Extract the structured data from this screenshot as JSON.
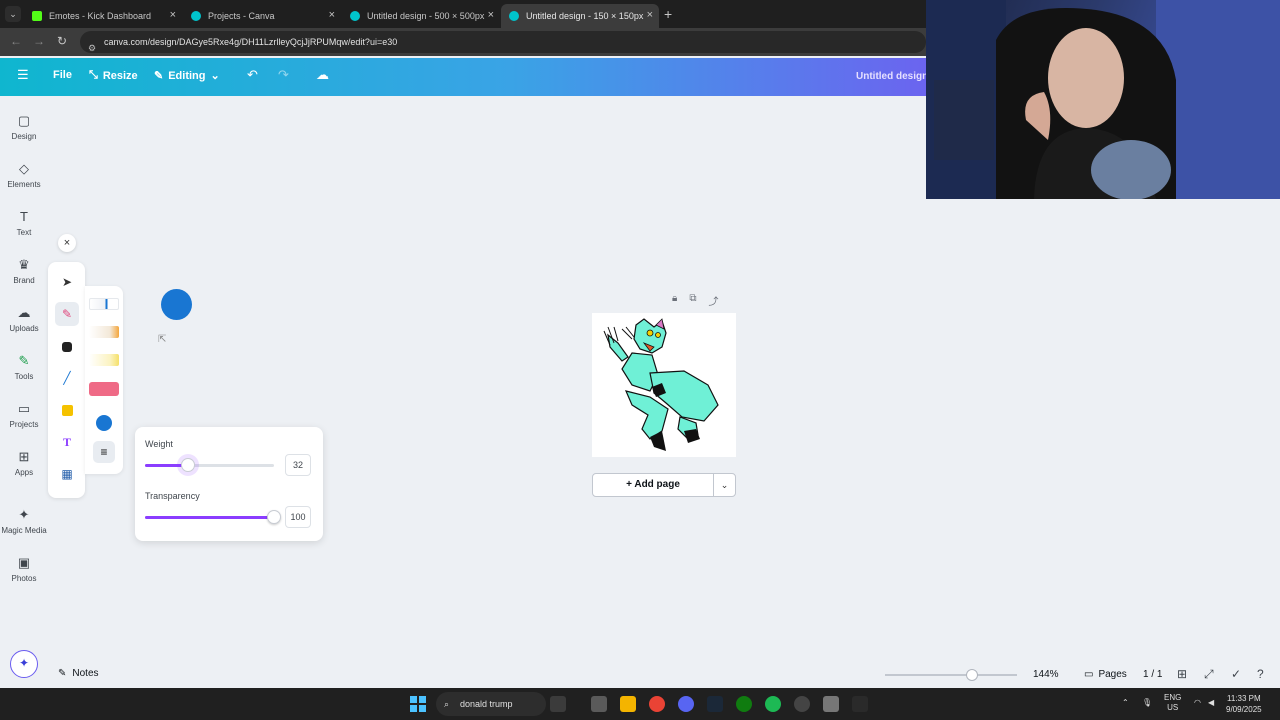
{
  "browser": {
    "tabs": [
      {
        "title": "Emotes - Kick Dashboard",
        "favicon_color": "#53fc18"
      },
      {
        "title": "Projects - Canva",
        "favicon_color": "#00c4cc"
      },
      {
        "title": "Untitled design - 500 × 500px",
        "favicon_color": "#00c4cc"
      },
      {
        "title": "Untitled design - 150 × 150px",
        "favicon_color": "#00c4cc"
      }
    ],
    "url": "canva.com/design/DAGye5Rxe4g/DH11LzrlleyQcjJjRPUMqw/edit?ui=e30"
  },
  "header": {
    "file_label": "File",
    "resize_label": "Resize",
    "editing_label": "Editing",
    "doc_title": "Untitled design"
  },
  "sidebar": {
    "items": [
      {
        "label": "Design",
        "icon": "design-icon"
      },
      {
        "label": "Elements",
        "icon": "elements-icon"
      },
      {
        "label": "Text",
        "icon": "text-icon"
      },
      {
        "label": "Brand",
        "icon": "brand-icon"
      },
      {
        "label": "Uploads",
        "icon": "uploads-icon"
      },
      {
        "label": "Tools",
        "icon": "tools-icon"
      },
      {
        "label": "Projects",
        "icon": "projects-icon"
      },
      {
        "label": "Apps",
        "icon": "apps-icon"
      },
      {
        "label": "Magic Media",
        "icon": "magic-media-icon"
      },
      {
        "label": "Photos",
        "icon": "photos-icon"
      }
    ]
  },
  "draw": {
    "selected_color": "#1976d2",
    "weight_label": "Weight",
    "weight_value": "32",
    "weight_fraction": 0.33,
    "transparency_label": "Transparency",
    "transparency_value": "100",
    "transparency_fraction": 1.0
  },
  "canvas": {
    "add_page_label": "+ Add page"
  },
  "footer": {
    "notes_label": "Notes",
    "zoom_label": "144%",
    "zoom_fraction": 0.66,
    "pages_label": "Pages",
    "page_count": "1 / 1"
  },
  "taskbar": {
    "search_text": "donald trump",
    "lang_top": "ENG",
    "lang_bottom": "US",
    "time": "11:33 PM",
    "date": "9/09/2025"
  }
}
